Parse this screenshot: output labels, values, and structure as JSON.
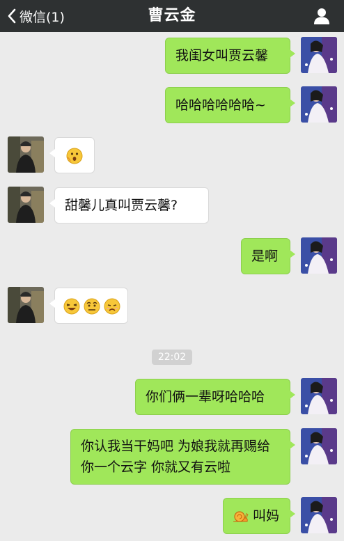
{
  "header": {
    "back_label": "微信(1)",
    "title": "曹云金"
  },
  "messages": [
    {
      "from": "me",
      "text": "我闺女叫贾云馨"
    },
    {
      "from": "me",
      "text": "哈哈哈哈哈哈~"
    },
    {
      "from": "him",
      "emojis": [
        "surprised-emoji"
      ]
    },
    {
      "from": "him",
      "text": "甜馨儿真叫贾云馨?"
    },
    {
      "from": "me",
      "text": "是啊"
    },
    {
      "from": "him",
      "emojis": [
        "laughing-emoji",
        "awkward-emoji",
        "sad-emoji"
      ]
    },
    {
      "from": "me",
      "text": "你们俩一辈呀哈哈哈"
    },
    {
      "from": "me",
      "text": "你认我当干妈吧 为娘我就再赐给你一个云字 你就又有云啦"
    },
    {
      "from": "me",
      "text": "叫妈",
      "emojis": [
        "snail-emoji"
      ]
    }
  ],
  "timestamp": "22:02",
  "colors": {
    "topbar": "#2e3132",
    "background": "#ebebeb",
    "my_bubble": "#a0e75a",
    "their_bubble": "#ffffff"
  }
}
